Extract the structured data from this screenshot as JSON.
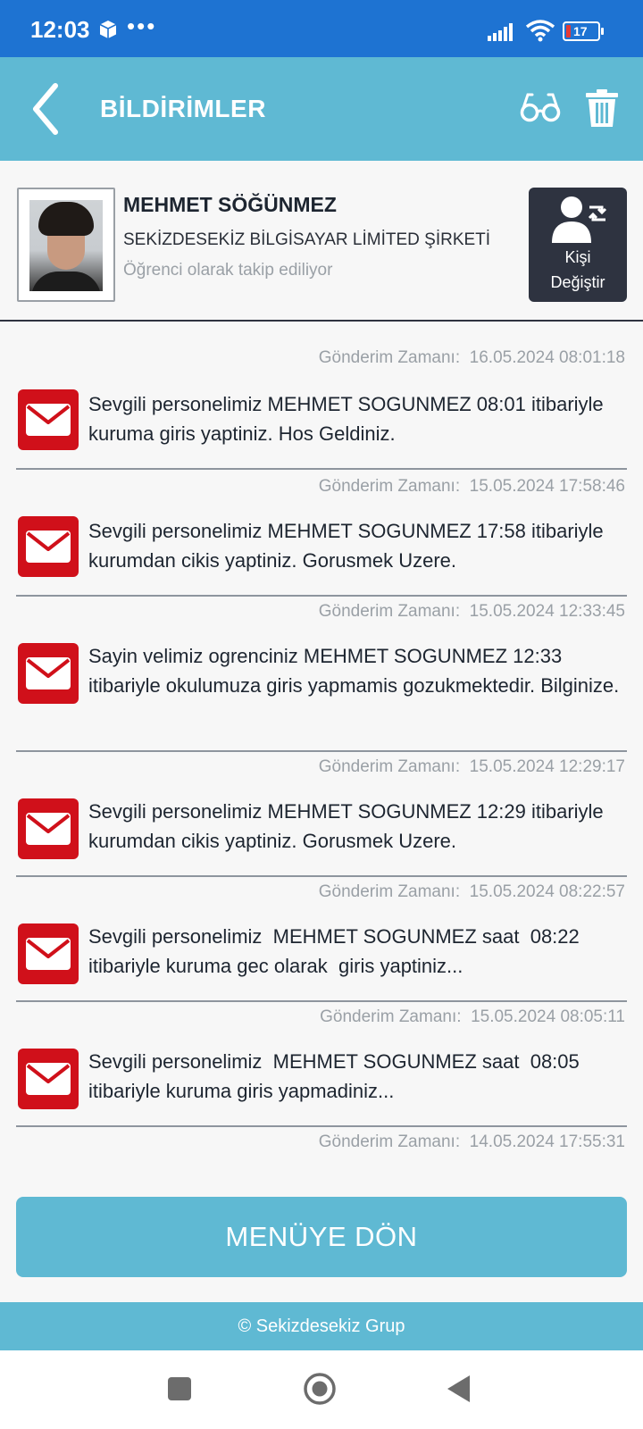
{
  "status_bar": {
    "time": "12:03",
    "dots": "•••",
    "battery_level": "17",
    "icons": [
      "package-icon",
      "signal-icon",
      "wifi-icon",
      "battery-icon"
    ]
  },
  "header": {
    "title": "BİLDİRİMLER",
    "icons": [
      "back-arrow-icon",
      "glasses-icon",
      "trash-icon"
    ]
  },
  "profile": {
    "name": "MEHMET SÖĞÜNMEZ",
    "company": "SEKİZDESEKİZ BİLGİSAYAR LİMİTED ŞİRKETİ",
    "status": "Öğrenci olarak takip ediliyor",
    "change_button": {
      "line1": "Kişi",
      "line2": "Değiştir"
    }
  },
  "notifications": [
    {
      "timestamp": "Gönderim Zamanı:  16.05.2024 08:01:18",
      "message": "Sevgili personelimiz MEHMET SOGUNMEZ 08:01 itibariyle kuruma giris yaptiniz. Hos Geldiniz."
    },
    {
      "timestamp": "Gönderim Zamanı:  15.05.2024 17:58:46",
      "message": "Sevgili personelimiz MEHMET SOGUNMEZ 17:58 itibariyle kurumdan cikis yaptiniz. Gorusmek Uzere."
    },
    {
      "timestamp": "Gönderim Zamanı:  15.05.2024 12:33:45",
      "message": "Sayin velimiz ogrenciniz MEHMET SOGUNMEZ 12:33 itibariyle okulumuza giris yapmamis gozukmektedir. Bilginize."
    },
    {
      "timestamp": "Gönderim Zamanı:  15.05.2024 12:29:17",
      "message": "Sevgili personelimiz MEHMET SOGUNMEZ 12:29 itibariyle kurumdan cikis yaptiniz. Gorusmek Uzere."
    },
    {
      "timestamp": "Gönderim Zamanı:  15.05.2024 08:22:57",
      "message": "Sevgili personelimiz  MEHMET SOGUNMEZ saat  08:22 itibariyle kuruma gec olarak  giris yaptiniz..."
    },
    {
      "timestamp": "Gönderim Zamanı:  15.05.2024 08:05:11",
      "message": "Sevgili personelimiz  MEHMET SOGUNMEZ saat  08:05 itibariyle kuruma giris yapmadiniz..."
    }
  ],
  "last_timestamp": "Gönderim Zamanı:  14.05.2024 17:55:31",
  "menu_button": "MENÜYE DÖN",
  "footer": "© Sekizdesekiz Grup",
  "colors": {
    "status_bar": "#1e73d2",
    "header": "#5fb9d3",
    "mail_icon": "#d0101a",
    "dark_button": "#2e3340"
  }
}
